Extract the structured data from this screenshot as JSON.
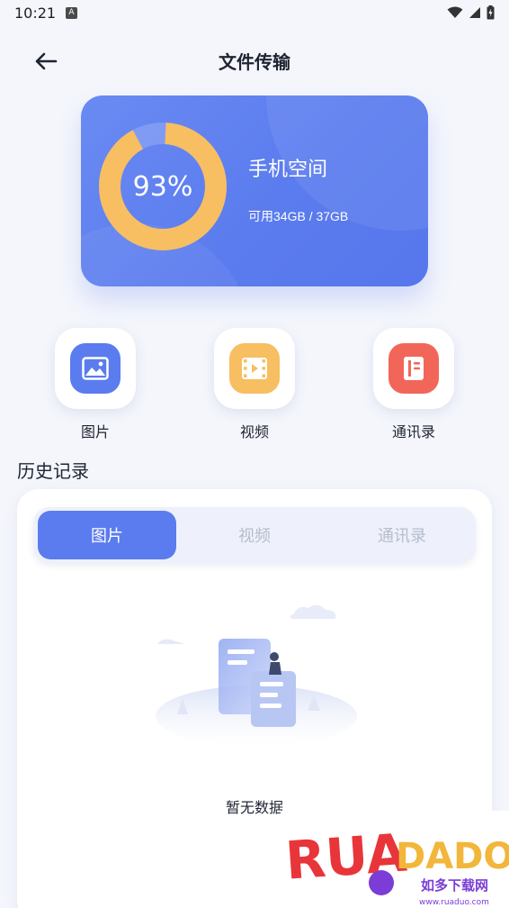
{
  "status_bar": {
    "time": "10:21",
    "badge": "A"
  },
  "header": {
    "title": "文件传输",
    "back_icon": "arrow-left-icon"
  },
  "storage": {
    "percent_text": "93%",
    "used_fraction": 0.93,
    "label": "手机空间",
    "detail": "可用34GB / 37GB",
    "ring_color": "#F7BE62",
    "card_color": "#5B7CEE"
  },
  "categories": [
    {
      "label": "图片",
      "icon": "image-icon",
      "color": "#5B7CEE"
    },
    {
      "label": "视频",
      "icon": "video-icon",
      "color": "#F7BE62"
    },
    {
      "label": "通讯录",
      "icon": "contacts-icon",
      "color": "#F2665A"
    }
  ],
  "history": {
    "title": "历史记录",
    "tabs": [
      "图片",
      "视频",
      "通讯录"
    ],
    "active_tab": "图片",
    "empty_text": "暂无数据"
  },
  "watermark": {
    "brand": "RUADADO",
    "subtitle": "如多下载网",
    "url": "www.ruaduo.com"
  }
}
